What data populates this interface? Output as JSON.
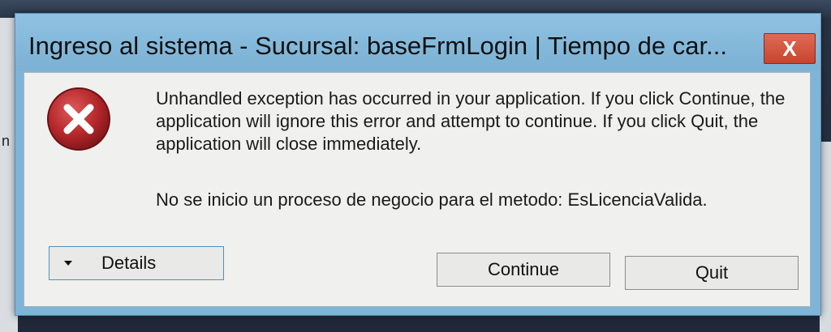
{
  "window": {
    "title": "Ingreso al sistema - Sucursal: baseFrmLogin | Tiempo de car...",
    "close_label": "X"
  },
  "background": {
    "left_char": "n"
  },
  "dialog": {
    "message": "Unhandled exception has occurred in your application. If you click Continue, the application will ignore this error and attempt to continue. If you click Quit, the application will close immediately.",
    "detail": "No se inicio un proceso de negocio para el metodo: EsLicenciaValida.",
    "icon": "error-x-icon"
  },
  "buttons": {
    "details": "Details",
    "continue": "Continue",
    "quit": "Quit"
  },
  "colors": {
    "titlebar": "#7cb1d4",
    "close": "#c7452e",
    "error_icon": "#b3262a"
  }
}
